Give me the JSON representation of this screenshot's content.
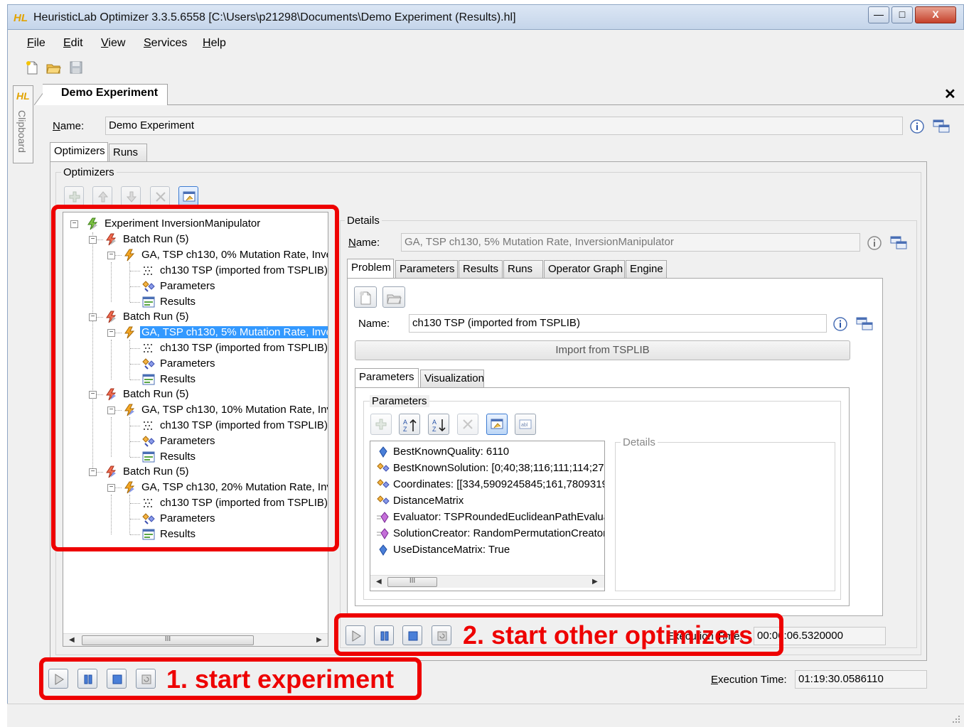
{
  "window": {
    "logo": "HL",
    "title": "HeuristicLab Optimizer 3.3.5.6558 [C:\\Users\\p21298\\Documents\\Demo Experiment (Results).hl]",
    "minimize": "—",
    "maximize": "□",
    "close": "X"
  },
  "menu": {
    "file_u": "F",
    "file_rest": "ile",
    "edit_u": "E",
    "edit_rest": "dit",
    "view_u": "V",
    "view_rest": "iew",
    "services_u": "S",
    "services_rest": "ervices",
    "help_u": "H",
    "help_rest": "elp"
  },
  "clipboard": {
    "logo": "HL",
    "label": "Clipboard"
  },
  "document": {
    "tab_label": "Demo Experiment",
    "close": "✕",
    "name_label_u": "N",
    "name_label_rest": "ame:",
    "name_value": "Demo Experiment",
    "tabs": {
      "optimizers": "Optimizers",
      "runs": "Runs"
    },
    "optimizers_group": "Optimizers",
    "execution_time_label": "Execution Time:",
    "execution_time_label_u": "E",
    "execution_time_label_rest": "xecution Time:",
    "execution_time_value": "01:19:30.0586110"
  },
  "tree": {
    "root": "Experiment InversionManipulator",
    "items": [
      {
        "batch": "Batch Run (5)",
        "ga": "GA, TSP ch130, 0% Mutation Rate, Inve",
        "problem": "ch130 TSP (imported from TSPLIB)",
        "params": "Parameters",
        "results": "Results"
      },
      {
        "batch": "Batch Run (5)",
        "ga": "GA, TSP ch130, 5% Mutation Rate, Inve",
        "problem": "ch130 TSP (imported from TSPLIB)",
        "params": "Parameters",
        "results": "Results"
      },
      {
        "batch": "Batch Run (5)",
        "ga": "GA, TSP ch130, 10% Mutation Rate, Inv",
        "problem": "ch130 TSP (imported from TSPLIB)",
        "params": "Parameters",
        "results": "Results"
      },
      {
        "batch": "Batch Run (5)",
        "ga": "GA, TSP ch130, 20% Mutation Rate, Inv",
        "problem": "ch130 TSP (imported from TSPLIB)",
        "params": "Parameters",
        "results": "Results"
      }
    ],
    "scroll_thumb": "III"
  },
  "details": {
    "group": "Details",
    "name_label_u": "N",
    "name_label_rest": "ame:",
    "name_value": "GA, TSP ch130, 5% Mutation Rate, InversionManipulator",
    "tabs": {
      "problem": "Problem",
      "parameters": "Parameters",
      "results": "Results",
      "runs": "Runs",
      "operator_graph": "Operator Graph",
      "engine": "Engine"
    },
    "problem_name_label": "Name:",
    "problem_name_value": "ch130 TSP (imported from TSPLIB)",
    "import_button": "Import from TSPLIB",
    "sub_tabs": {
      "parameters": "Parameters",
      "visualization": "Visualization"
    },
    "params_group": "Parameters",
    "details_group": "Details",
    "parameters": [
      {
        "text": "BestKnownQuality: 6110"
      },
      {
        "text": "BestKnownSolution: [0;40;38;116;111;114;27;"
      },
      {
        "text": "Coordinates: [[334,5909245845;161,7809319"
      },
      {
        "text": "DistanceMatrix"
      },
      {
        "text": "Evaluator: TSPRoundedEuclideanPathEvalua"
      },
      {
        "text": "SolutionCreator: RandomPermutationCreator"
      },
      {
        "text": "UseDistanceMatrix: True"
      }
    ],
    "scroll_thumb": "III",
    "execution_time_label": "Execution Time:",
    "execution_time_value": "00:06:06.5320000"
  },
  "annotations": {
    "start_experiment": "1. start experiment",
    "start_other": "2. start other optimizers"
  },
  "colors": {
    "annotation": "#ee0000",
    "selection": "#3399ff",
    "logo": "#e2a300"
  }
}
